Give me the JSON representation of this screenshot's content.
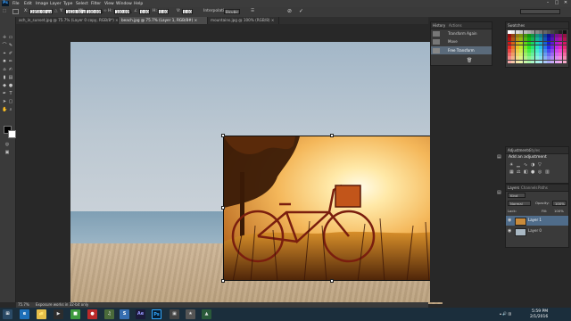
{
  "app": {
    "logo": "Ps"
  },
  "menu": [
    "File",
    "Edit",
    "Image",
    "Layer",
    "Type",
    "Select",
    "Filter",
    "View",
    "Window",
    "Help"
  ],
  "window_controls": {
    "minimize": "–",
    "restore": "□",
    "close": "✕"
  },
  "options": {
    "x_label": "X:",
    "x_value": "2850.00 px",
    "y_label": "Y:",
    "y_value": "1630.00 px",
    "w_label": "W:",
    "w_value": "100.00%",
    "h_label": "H:",
    "h_value": "100.00%",
    "angle_value": "0.00",
    "hskew_value": "0.00",
    "vskew_value": "0.00",
    "interpolation_label": "Interpolation:",
    "interpolation_value": "Bicubic"
  },
  "tabs": [
    "ach_in_sunset.jpg @ 75.7% (Layer 0 copy, RGB/8*) ×",
    "beach.jpg @ 75.7% (Layer 1, RGB/8#) ×",
    "mountains.jpg @ 100% (RGB/8) ×"
  ],
  "history_panel": {
    "tabs": [
      "History",
      "Actions"
    ],
    "items": [
      "Transform Again",
      "Move",
      "Free Transform"
    ]
  },
  "swatches_panel": {
    "tabs": [
      "Swatches"
    ]
  },
  "adjustments_panel": {
    "tabs": [
      "Adjustments",
      "Styles"
    ],
    "add_label": "Add an adjustment"
  },
  "layers_panel": {
    "tabs": [
      "Layers",
      "Channels",
      "Paths"
    ],
    "kind_label": "Kind",
    "blend_mode": "Normal",
    "opacity_label": "Opacity:",
    "opacity_value": "100%",
    "lock_label": "Lock:",
    "fill_label": "Fill:",
    "fill_value": "100%",
    "layers": [
      {
        "name": "Layer 1",
        "selected": true
      },
      {
        "name": "Layer 0",
        "selected": false
      }
    ]
  },
  "status": {
    "zoom": "75.7%",
    "info": "Exposure works in 32-bit only"
  },
  "taskbar": {
    "time": "5:59 PM",
    "date": "2/1/2016",
    "apps": [
      "Ae",
      "Ps"
    ]
  },
  "colors": {
    "accent": "#0b6fc4",
    "ps_blue": "#31a8ff",
    "ae_purple": "#9999ff"
  }
}
